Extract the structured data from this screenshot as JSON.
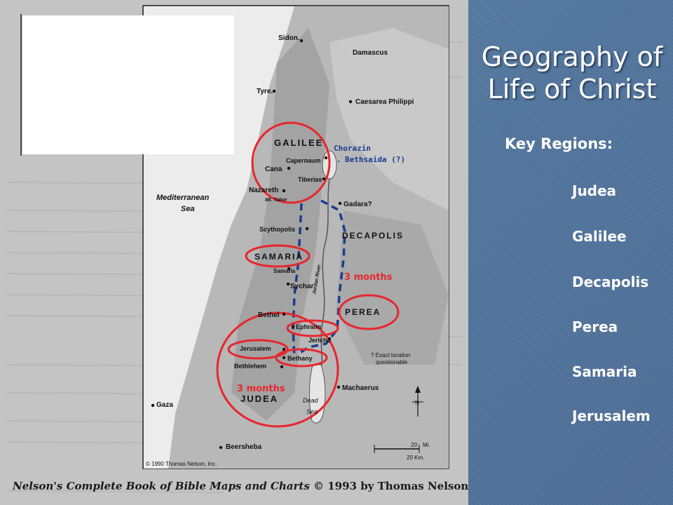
{
  "slide": {
    "title_line1": "Geography of",
    "title_line2": "Life of Christ",
    "key_heading": "Key Regions:",
    "regions": [
      "Judea",
      "Galilee",
      "Decapolis",
      "Perea",
      "Samaria",
      "Jerusalem"
    ]
  },
  "map": {
    "places": {
      "sidon": "Sidon.",
      "damascus": "Damascus",
      "tyre": "Tyre.",
      "caesarea_philippi": "Caesarea Philippi",
      "galilee": "GALILEE",
      "chorazin": "Chorazin",
      "bethsaida": "Bethsaida (?)",
      "capernaum": "Capernaum",
      "cana": "Cana",
      "tiberias": "Tiberias",
      "nazareth": "Nazareth",
      "mt_tabor": "Mt. Tabor",
      "gadara": "Gadara?",
      "mediterranean": "Mediterranean",
      "sea": "Sea",
      "scythopolis": "Scythopolis",
      "decapolis": "DECAPOLIS",
      "samaria_region": "SAMARIA",
      "samaria_city": "Samaria",
      "jordan_river": "Jordan River",
      "sychar": "Sychar",
      "bethel": "Bethel",
      "ephraim": "Ephraim",
      "perea": "PEREA",
      "jericho": "Jericho",
      "jerusalem": "Jerusalem",
      "bethany": "Bethany",
      "bethlehem": "Bethlehem",
      "exact_location_line1": "? Exact location",
      "exact_location_line2": "questionable",
      "machaerus": "Machaerus",
      "gaza": "Gaza",
      "judea": "JUDEA",
      "dead": "Dead",
      "dead_sea": "Sea",
      "beersheba": "Beersheba",
      "north": "N",
      "scale_20": "20",
      "scale_mi": "Mi.",
      "scale_km": "20 Km.",
      "copyright": "© 1990 Thomas Nelson, Inc."
    },
    "annotations": {
      "three_months_north": "3 months",
      "three_months_south": "3 months"
    },
    "annotation_color": "#e8262d",
    "route_color": "#1a3c8f",
    "label_color": "#1a3c8f"
  },
  "credit": {
    "title": "Nelson's Complete Book of Bible Maps and Charts",
    "rest": " © 1993 by Thomas Nelson, Inc."
  }
}
